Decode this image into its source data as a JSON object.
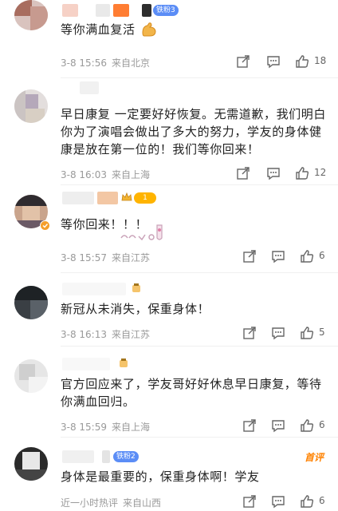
{
  "comments": [
    {
      "badge": "铁粉3",
      "text": "等你满血复活",
      "time": "3-8 15:56",
      "location": "来自北京",
      "likes": "18"
    },
    {
      "text": "早日康复 一定要好好恢复。无需道歉，我们明白你为了演唱会做出了多大的努力，学友的身体健康是放在第一位的！我们等你回来！",
      "time": "3-8 16:03",
      "location": "来自上海",
      "likes": "12"
    },
    {
      "badge": "1",
      "text": "等你回来！！！",
      "time": "3-8 15:57",
      "location": "来自江苏",
      "likes": "6"
    },
    {
      "text": "新冠从未消失，保重身体！",
      "time": "3-8 16:13",
      "location": "来自江苏",
      "likes": "5"
    },
    {
      "text": "官方回应来了，学友哥好好休息早日康复，等待你满血回归。",
      "time": "3-8 15:59",
      "location": "来自上海",
      "likes": "6"
    },
    {
      "badge": "铁粉2",
      "first_tag": "首评",
      "text": "身体是最重要的，保重身体啊！学友",
      "time": "近一小时热评",
      "location": "来自山西",
      "likes": "6"
    }
  ],
  "icons": {
    "share": "share-icon",
    "comment": "comment-icon",
    "like": "thumbs-up-icon"
  },
  "colors": {
    "meta": "#9a9a9a",
    "badge_blue": "#5b8df6",
    "accent_orange": "#ff8200"
  }
}
